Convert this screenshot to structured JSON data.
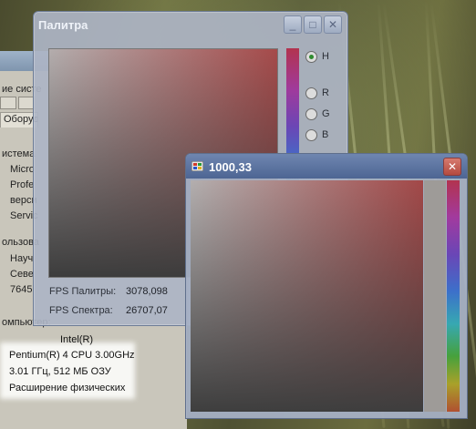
{
  "sysprops": {
    "lines": [
      {
        "text": "ие систе"
      },
      {
        "text": "Оборудо"
      },
      {
        "text": "истема"
      },
      {
        "text": "Micro"
      },
      {
        "text": "Profe"
      },
      {
        "text": "верси"
      },
      {
        "text": "Servic"
      },
      {
        "text": "ользова"
      },
      {
        "text": "Науч"
      },
      {
        "text": "Севе"
      },
      {
        "text": "7645"
      },
      {
        "text": "омпьютер:"
      },
      {
        "text": "Intel(R)"
      },
      {
        "text": "Pentium(R) 4 CPU 3.00GHz"
      },
      {
        "text": "3.01 ГГц, 512 МБ ОЗУ"
      },
      {
        "text": "Расширение физических"
      }
    ]
  },
  "palette": {
    "title": "Палитра",
    "minimize": "_",
    "maximize": "□",
    "close": "✕",
    "radios": [
      {
        "label": "H",
        "checked": true
      },
      {
        "label": "R",
        "checked": false
      },
      {
        "label": "G",
        "checked": false
      },
      {
        "label": "B",
        "checked": false
      }
    ],
    "fps_palette_label": "FPS Палитры:",
    "fps_palette_value": "3078,098",
    "fps_spectrum_label": "FPS Спектра:",
    "fps_spectrum_value": "26707,07"
  },
  "spectrum": {
    "title": "1000,33",
    "close": "✕"
  }
}
